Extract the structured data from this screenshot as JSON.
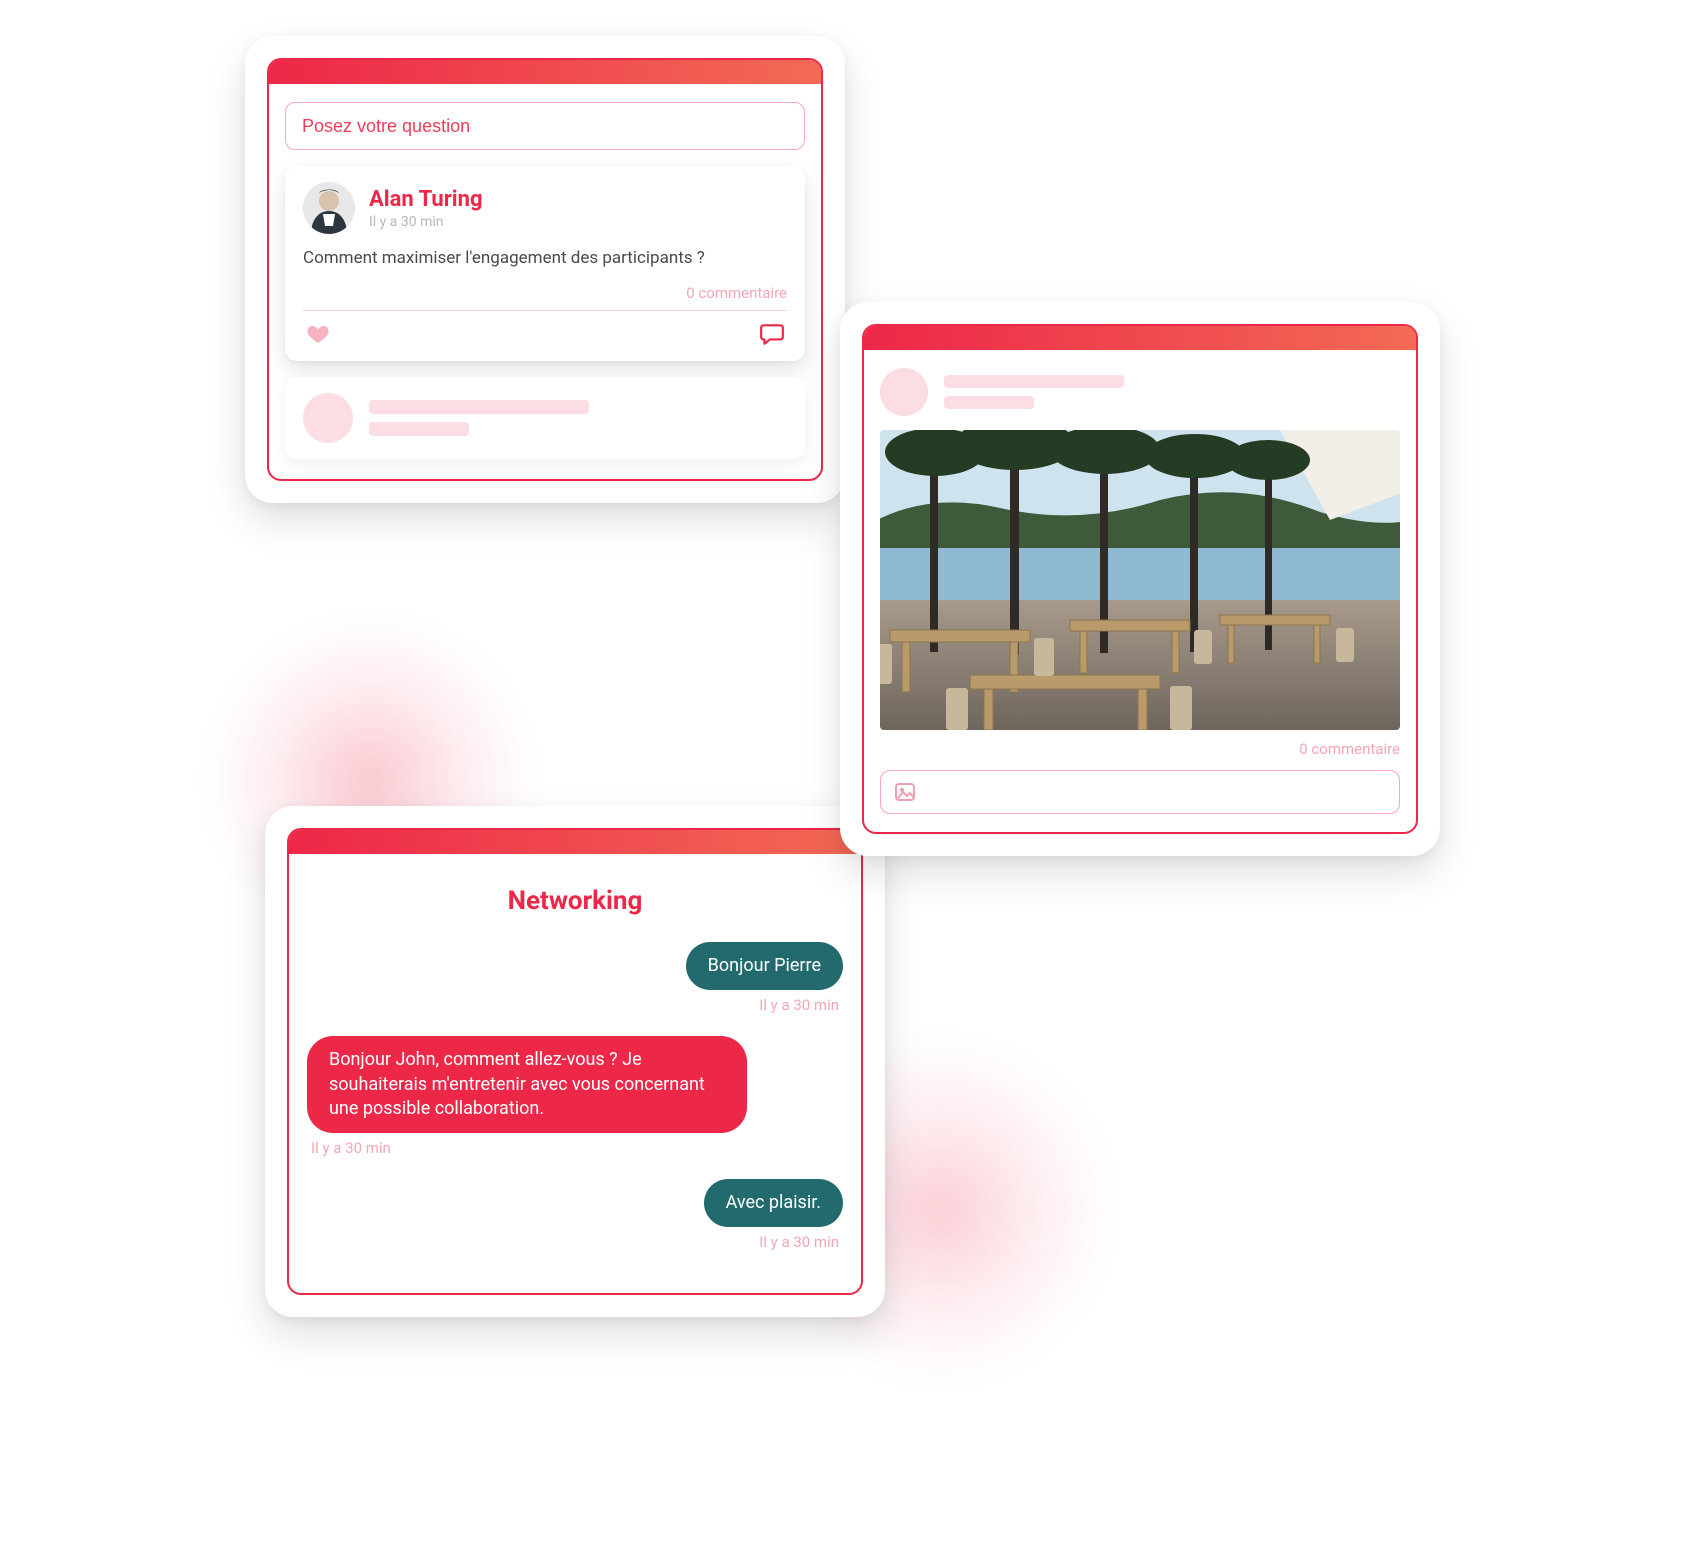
{
  "qa": {
    "placeholder": "Posez votre question",
    "post": {
      "author": "Alan Turing",
      "time": "Il y a 30 min",
      "text": "Comment maximiser l'engagement des participants ?",
      "comments": "0 commentaire"
    }
  },
  "imgpost": {
    "comments": "0 commentaire"
  },
  "chat": {
    "title": "Networking",
    "messages": [
      {
        "text": "Bonjour Pierre",
        "time": "Il y a 30 min"
      },
      {
        "text": "Bonjour John, comment allez-vous ? Je souhaiterais m'entretenir avec vous concernant une possible collaboration.",
        "time": "Il y a 30 min"
      },
      {
        "text": "Avec plaisir.",
        "time": "Il y a 30 min"
      }
    ]
  }
}
